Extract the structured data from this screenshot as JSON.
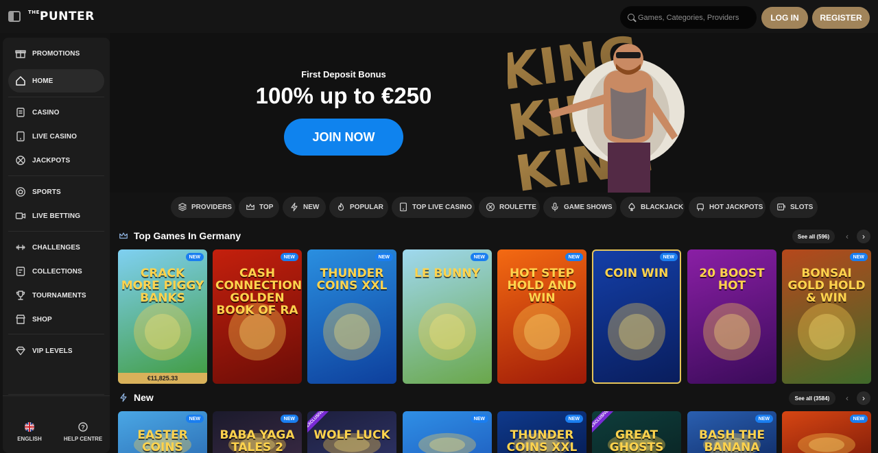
{
  "header": {
    "logo": "PUNTER",
    "search_placeholder": "Games, Categories, Providers",
    "login_label": "LOG IN",
    "register_label": "REGISTER"
  },
  "sidebar": {
    "items": [
      {
        "label": "PROMOTIONS",
        "icon": "gift-icon"
      },
      {
        "label": "HOME",
        "icon": "home-icon",
        "active": true
      },
      {
        "label": "CASINO",
        "icon": "cards-icon"
      },
      {
        "label": "LIVE CASINO",
        "icon": "live-card-icon"
      },
      {
        "label": "JACKPOTS",
        "icon": "jackpot-icon"
      },
      {
        "label": "SPORTS",
        "icon": "ball-icon"
      },
      {
        "label": "LIVE BETTING",
        "icon": "live-bet-icon"
      },
      {
        "label": "CHALLENGES",
        "icon": "challenge-icon"
      },
      {
        "label": "COLLECTIONS",
        "icon": "collection-icon"
      },
      {
        "label": "TOURNAMENTS",
        "icon": "trophy-icon"
      },
      {
        "label": "SHOP",
        "icon": "shop-icon"
      },
      {
        "label": "VIP LEVELS",
        "icon": "diamond-icon"
      }
    ],
    "footer": {
      "language": "ENGLISH",
      "help": "HELP CENTRE"
    }
  },
  "hero": {
    "subtitle": "First Deposit Bonus",
    "title": "100% up to €250",
    "cta": "JOIN NOW",
    "art_text": "KING"
  },
  "categories": [
    {
      "label": "PROVIDERS",
      "icon": "layers-icon"
    },
    {
      "label": "TOP",
      "icon": "crown-icon"
    },
    {
      "label": "NEW",
      "icon": "lightning-icon"
    },
    {
      "label": "POPULAR",
      "icon": "flame-icon"
    },
    {
      "label": "TOP LIVE CASINO",
      "icon": "live-card-icon"
    },
    {
      "label": "ROULETTE",
      "icon": "roulette-icon"
    },
    {
      "label": "GAME SHOWS",
      "icon": "microphone-icon"
    },
    {
      "label": "BLACKJACK",
      "icon": "spade-icon"
    },
    {
      "label": "HOT JACKPOTS",
      "icon": "hot-jackpot-icon"
    },
    {
      "label": "SLOTS",
      "icon": "slot-icon"
    }
  ],
  "sections": [
    {
      "title": "Top Games In Germany",
      "icon": "crown-icon",
      "see_all": "See all (596)",
      "games": [
        {
          "name": "CRACK MORE PIGGY BANKS",
          "badge": "NEW",
          "jackpot": "€11,825.33",
          "colors": [
            "#7fd0f2",
            "#3f9a3b"
          ]
        },
        {
          "name": "CASH CONNECTION GOLDEN BOOK OF RA",
          "badge": "NEW",
          "colors": [
            "#c4200d",
            "#6b0d07"
          ]
        },
        {
          "name": "THUNDER COINS XXL",
          "badge": "NEW",
          "colors": [
            "#2a8fe0",
            "#0d3f9c"
          ]
        },
        {
          "name": "LE BUNNY",
          "badge": "NEW",
          "colors": [
            "#9fd8ef",
            "#6aa74a"
          ]
        },
        {
          "name": "HOT STEP HOLD AND WIN",
          "badge": "NEW",
          "colors": [
            "#f46a12",
            "#9e1a08"
          ]
        },
        {
          "name": "COIN WIN",
          "badge": "NEW",
          "colors": [
            "#143fa8",
            "#091d5c"
          ]
        },
        {
          "name": "20 BOOST HOT",
          "badge": "",
          "colors": [
            "#8a1fa5",
            "#3a0b59"
          ]
        },
        {
          "name": "BONSAI GOLD HOLD & WIN",
          "badge": "NEW",
          "colors": [
            "#b6481c",
            "#3f6a2a"
          ]
        }
      ]
    },
    {
      "title": "New",
      "icon": "lightning-icon",
      "see_all": "See all (3584)",
      "games": [
        {
          "name": "EASTER COINS",
          "badge": "NEW",
          "colors": [
            "#4aa7e5",
            "#2c6db3"
          ]
        },
        {
          "name": "BABA YAGA TALES 2",
          "badge": "NEW",
          "colors": [
            "#1b1a2c",
            "#3a2a44"
          ]
        },
        {
          "name": "WOLF LUCK",
          "badge": "",
          "exclusive": "EXCLUSIVE",
          "colors": [
            "#1d1f3d",
            "#2e3366"
          ]
        },
        {
          "name": "",
          "badge": "NEW",
          "colors": [
            "#2f8fe6",
            "#1f5fc0"
          ]
        },
        {
          "name": "THUNDER COINS XXL MULTICOIN",
          "badge": "NEW",
          "colors": [
            "#0f3a8c",
            "#061b52"
          ]
        },
        {
          "name": "GREAT GHOSTS",
          "badge": "",
          "exclusive": "EXCLUSIVE",
          "colors": [
            "#0e3d3b",
            "#0a2424"
          ]
        },
        {
          "name": "BASH THE BANANA STASH",
          "badge": "NEW",
          "colors": [
            "#2a5fb0",
            "#0f2b66"
          ]
        },
        {
          "name": "",
          "badge": "NEW",
          "colors": [
            "#d74613",
            "#7c1a08"
          ]
        }
      ]
    }
  ]
}
